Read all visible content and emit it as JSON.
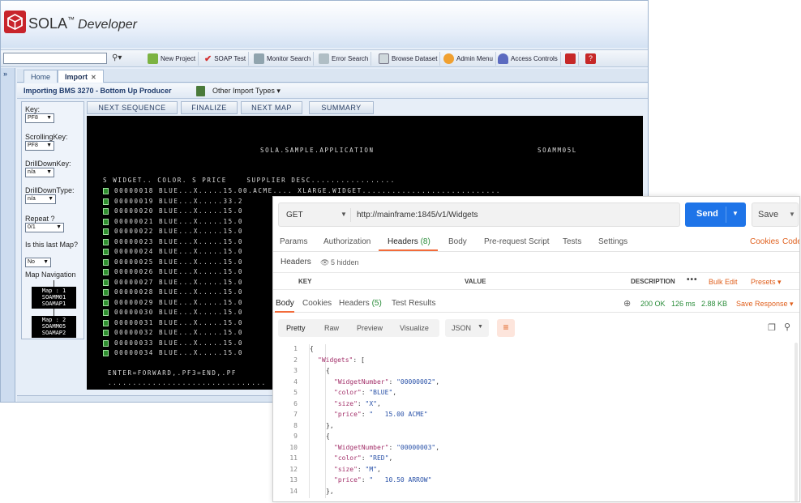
{
  "sola": {
    "brand": "SOLA",
    "trademark": "™",
    "product": "Developer",
    "toolbar": {
      "search_placeholder": "",
      "buttons": [
        "New Project",
        "SOAP Test",
        "Monitor Search",
        "Error Search",
        "Browse Dataset",
        "Admin Menu",
        "Access Controls"
      ]
    },
    "collapse_label": "»",
    "tabs": [
      {
        "label": "Home"
      },
      {
        "label": "Import",
        "close": "✕"
      }
    ],
    "import_title": "Importing BMS 3270 - Bottom Up Producer",
    "other_import_types": "Other Import Types ▾",
    "side": {
      "key_label": "Key:",
      "key_value": "PF8",
      "scrolling_key_label": "ScrollingKey:",
      "scrolling_key_value": "PF8",
      "drilldown_key_label": "DrillDownKey:",
      "drilldown_key_value": "n/a",
      "drilldown_type_label": "DrillDownType:",
      "drilldown_type_value": "n/a",
      "repeat_label": "Repeat ?",
      "repeat_value": "0/1",
      "last_map_label": "Is this last Map?",
      "last_map_value": "No",
      "map_nav_label": "Map Navigation",
      "maps": [
        {
          "line1": "Map : 1",
          "line2": "SOAMM01",
          "line3": "SOAMAP1"
        },
        {
          "line1": "Map : 2",
          "line2": "SOAMM05",
          "line3": "SOAMAP2"
        }
      ]
    },
    "seq_buttons": [
      "NEXT SEQUENCE",
      "FINALIZE",
      "NEXT MAP",
      "SUMMARY"
    ],
    "terminal": {
      "app_title": "SOLA.SAMPLE.APPLICATION",
      "map_id": "SOAMM05L",
      "header": "S WIDGET.. COLOR. S PRICE    SUPPLIER DESC.................",
      "rows": [
        "00000018 BLUE...X.....15.00.ACME.... XLARGE.WIDGET............................",
        "00000019 BLUE...X.....33.2",
        "00000020 BLUE...X.....15.0",
        "00000021 BLUE...X.....15.0",
        "00000022 BLUE...X.....15.0",
        "00000023 BLUE...X.....15.0",
        "00000024 BLUE...X.....15.0",
        "00000025 BLUE...X.....15.0",
        "00000026 BLUE...X.....15.0",
        "00000027 BLUE...X.....15.0",
        "00000028 BLUE...X.....15.0",
        "00000029 BLUE...X.....15.0",
        "00000030 BLUE...X.....15.0",
        "00000031 BLUE...X.....15.0",
        "00000032 BLUE...X.....15.0",
        "00000033 BLUE...X.....15.0",
        "00000034 BLUE...X.....15.0"
      ],
      "footer": "ENTER=FORWARD,.PF3=END,.PF",
      "footer2": "................................"
    }
  },
  "postman": {
    "method": "GET",
    "url": "http://mainframe:1845/v1/Widgets",
    "send_label": "Send",
    "save_label": "Save",
    "request_tabs": [
      "Params",
      "Authorization",
      "Headers",
      "Body",
      "Pre-request Script",
      "Tests",
      "Settings"
    ],
    "headers_count": "(8)",
    "cookies_link": "Cookies",
    "code_link": "Code",
    "headers_label": "Headers",
    "hidden_label": "5 hidden",
    "kv_columns": {
      "key": "KEY",
      "value": "VALUE",
      "description": "DESCRIPTION"
    },
    "bulk_edit": "Bulk Edit",
    "presets": "Presets ▾",
    "response_tabs": [
      "Body",
      "Cookies",
      "Headers",
      "Test Results"
    ],
    "response_headers_count": "(5)",
    "status": "200 OK",
    "time": "126 ms",
    "size": "2.88 KB",
    "save_response": "Save Response ▾",
    "views": [
      "Pretty",
      "Raw",
      "Preview",
      "Visualize"
    ],
    "format": "JSON",
    "code_lines": [
      {
        "n": "1",
        "indent": 0,
        "parts": [
          {
            "t": "{",
            "c": "p"
          }
        ]
      },
      {
        "n": "2",
        "indent": 1,
        "parts": [
          {
            "t": "\"Widgets\"",
            "c": "k"
          },
          {
            "t": ": [",
            "c": "p"
          }
        ]
      },
      {
        "n": "3",
        "indent": 2,
        "parts": [
          {
            "t": "{",
            "c": "p"
          }
        ]
      },
      {
        "n": "4",
        "indent": 3,
        "parts": [
          {
            "t": "\"WidgetNumber\"",
            "c": "k"
          },
          {
            "t": ": ",
            "c": "p"
          },
          {
            "t": "\"00000002\"",
            "c": "s"
          },
          {
            "t": ",",
            "c": "p"
          }
        ]
      },
      {
        "n": "5",
        "indent": 3,
        "parts": [
          {
            "t": "\"color\"",
            "c": "k"
          },
          {
            "t": ": ",
            "c": "p"
          },
          {
            "t": "\"BLUE\"",
            "c": "s"
          },
          {
            "t": ",",
            "c": "p"
          }
        ]
      },
      {
        "n": "6",
        "indent": 3,
        "parts": [
          {
            "t": "\"size\"",
            "c": "k"
          },
          {
            "t": ": ",
            "c": "p"
          },
          {
            "t": "\"X\"",
            "c": "s"
          },
          {
            "t": ",",
            "c": "p"
          }
        ]
      },
      {
        "n": "7",
        "indent": 3,
        "parts": [
          {
            "t": "\"price\"",
            "c": "k"
          },
          {
            "t": ": ",
            "c": "p"
          },
          {
            "t": "\"   15.00 ACME\"",
            "c": "s"
          }
        ]
      },
      {
        "n": "8",
        "indent": 2,
        "parts": [
          {
            "t": "},",
            "c": "p"
          }
        ]
      },
      {
        "n": "9",
        "indent": 2,
        "parts": [
          {
            "t": "{",
            "c": "p"
          }
        ]
      },
      {
        "n": "10",
        "indent": 3,
        "parts": [
          {
            "t": "\"WidgetNumber\"",
            "c": "k"
          },
          {
            "t": ": ",
            "c": "p"
          },
          {
            "t": "\"00000003\"",
            "c": "s"
          },
          {
            "t": ",",
            "c": "p"
          }
        ]
      },
      {
        "n": "11",
        "indent": 3,
        "parts": [
          {
            "t": "\"color\"",
            "c": "k"
          },
          {
            "t": ": ",
            "c": "p"
          },
          {
            "t": "\"RED\"",
            "c": "s"
          },
          {
            "t": ",",
            "c": "p"
          }
        ]
      },
      {
        "n": "12",
        "indent": 3,
        "parts": [
          {
            "t": "\"size\"",
            "c": "k"
          },
          {
            "t": ": ",
            "c": "p"
          },
          {
            "t": "\"M\"",
            "c": "s"
          },
          {
            "t": ",",
            "c": "p"
          }
        ]
      },
      {
        "n": "13",
        "indent": 3,
        "parts": [
          {
            "t": "\"price\"",
            "c": "k"
          },
          {
            "t": ": ",
            "c": "p"
          },
          {
            "t": "\"   10.50 ARROW\"",
            "c": "s"
          }
        ]
      },
      {
        "n": "14",
        "indent": 2,
        "parts": [
          {
            "t": "},",
            "c": "p"
          }
        ]
      }
    ],
    "colors": {
      "send": "#1e74e8",
      "accent": "#f26b3a",
      "status_ok": "#2a8c3a",
      "json_key": "#a3306a",
      "json_string": "#2a52a8"
    }
  }
}
